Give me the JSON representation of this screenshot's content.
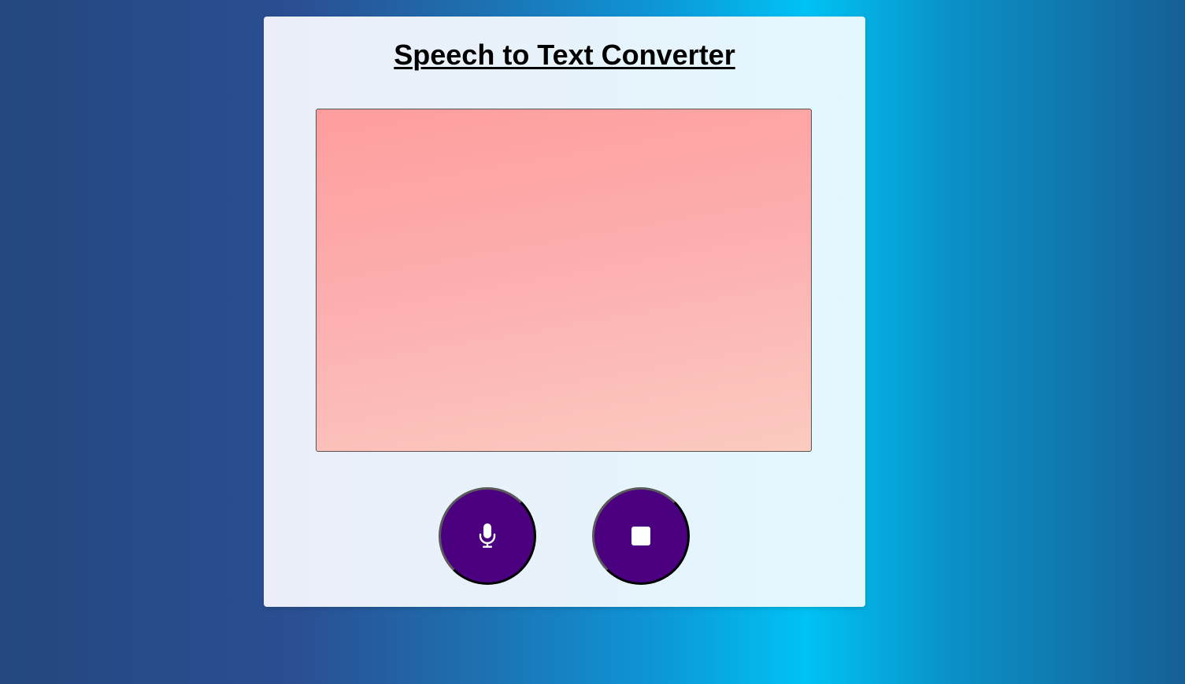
{
  "header": {
    "title": "Speech to Text Converter"
  },
  "transcript": {
    "value": "",
    "placeholder": ""
  },
  "controls": {
    "start_icon": "microphone-icon",
    "stop_icon": "stop-icon",
    "button_color": "#4b007f"
  },
  "colors": {
    "textarea_gradient_start": "#ff9d9d",
    "textarea_gradient_end": "#fbcbc0",
    "card_background": "#ebeef7"
  }
}
